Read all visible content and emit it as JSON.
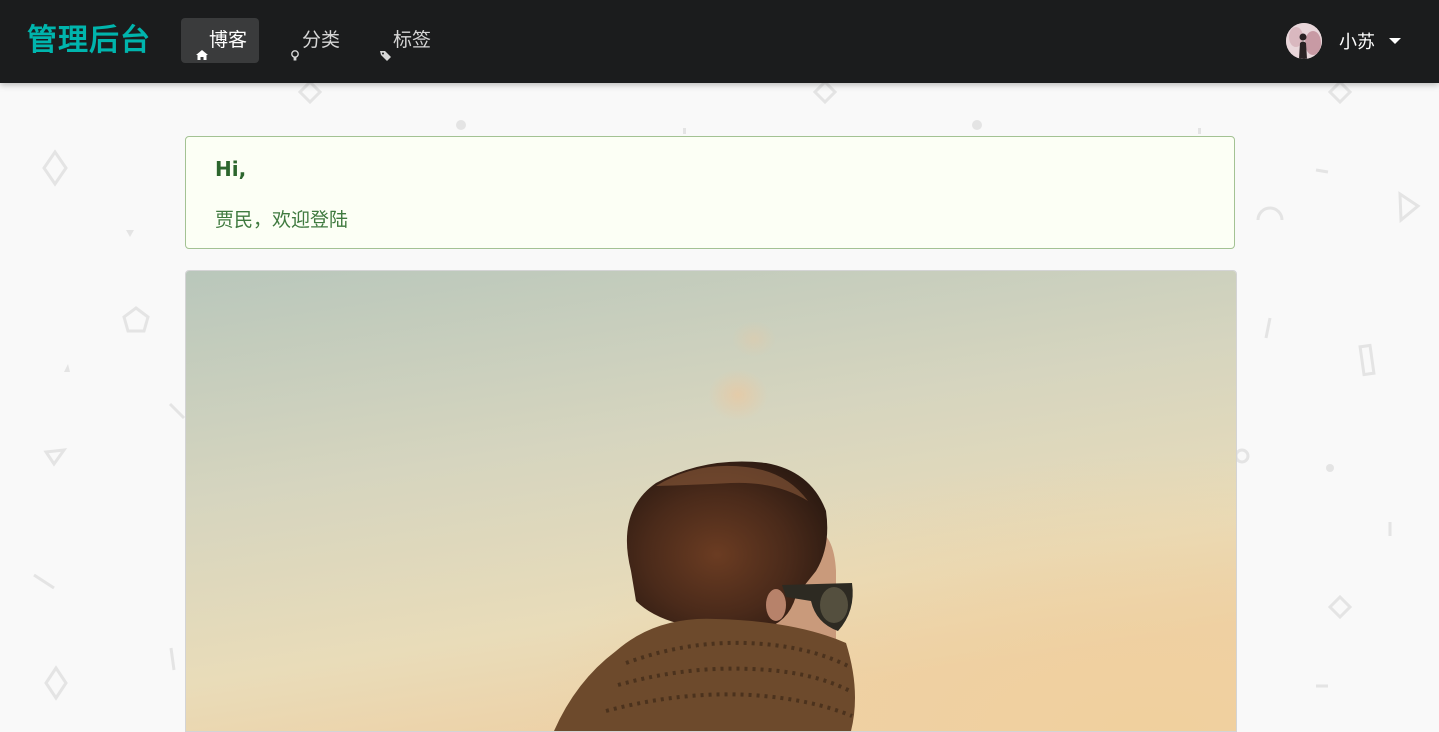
{
  "navbar": {
    "brand": "管理后台",
    "items": [
      {
        "label": "博客",
        "icon": "home-icon",
        "active": true
      },
      {
        "label": "分类",
        "icon": "idea-icon",
        "active": false
      },
      {
        "label": "标签",
        "icon": "tags-icon",
        "active": false
      }
    ],
    "user": {
      "name": "小苏",
      "avatar_icon": "avatar"
    }
  },
  "welcome": {
    "title": "Hi,",
    "message": "贾民，欢迎登陆"
  },
  "colors": {
    "brand": "#00b5ad",
    "navbar_bg": "#1b1c1d",
    "success_bg": "#fcfff5",
    "success_border": "#a3c293",
    "success_text": "#2c662d"
  }
}
